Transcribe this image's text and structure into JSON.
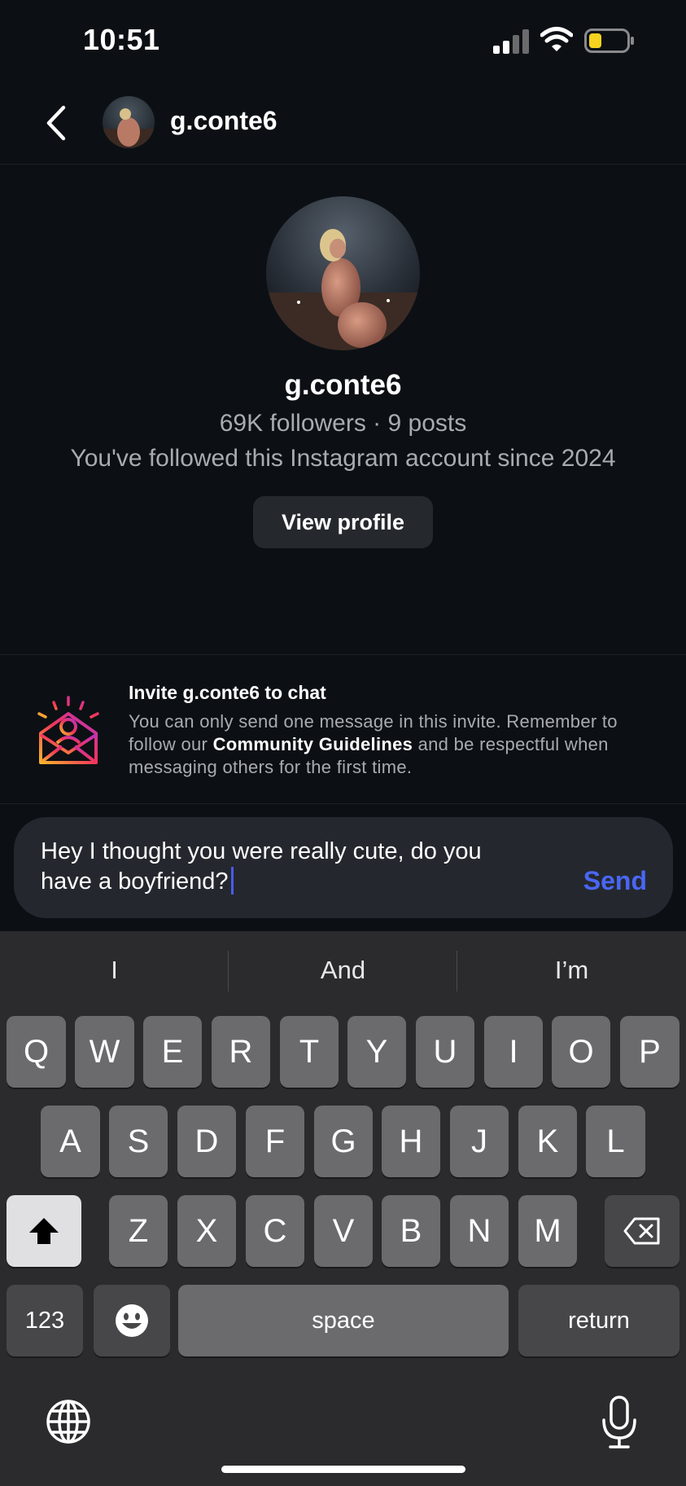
{
  "status": {
    "time": "10:51"
  },
  "header": {
    "username": "g.conte6"
  },
  "profile": {
    "name": "g.conte6",
    "stats": "69K followers · 9 posts",
    "since": "You've followed this Instagram account since 2024",
    "view_button": "View profile"
  },
  "invite": {
    "title": "Invite g.conte6 to chat",
    "text_before": "You can only send one message in this invite. Remember to follow our ",
    "link": "Community Guidelines",
    "text_after": " and be respectful when messaging others for the first time."
  },
  "composer": {
    "message": "Hey I thought you were really cute, do you have a boyfriend?",
    "send_label": "Send"
  },
  "keyboard": {
    "suggestions": [
      "I",
      "And",
      "I’m"
    ],
    "row1": [
      "Q",
      "W",
      "E",
      "R",
      "T",
      "Y",
      "U",
      "I",
      "O",
      "P"
    ],
    "row2": [
      "A",
      "S",
      "D",
      "F",
      "G",
      "H",
      "J",
      "K",
      "L"
    ],
    "row3": [
      "Z",
      "X",
      "C",
      "V",
      "B",
      "N",
      "M"
    ],
    "numbers_label": "123",
    "space_label": "space",
    "return_label": "return"
  },
  "colors": {
    "accent": "#4a66f5",
    "background": "#0c1014",
    "keyboard": "#2b2b2d"
  },
  "icons": [
    "back-chevron-icon",
    "signal-icon",
    "wifi-icon",
    "battery-icon",
    "invite-envelope-icon",
    "shift-icon",
    "delete-icon",
    "emoji-icon",
    "globe-icon",
    "microphone-icon"
  ]
}
